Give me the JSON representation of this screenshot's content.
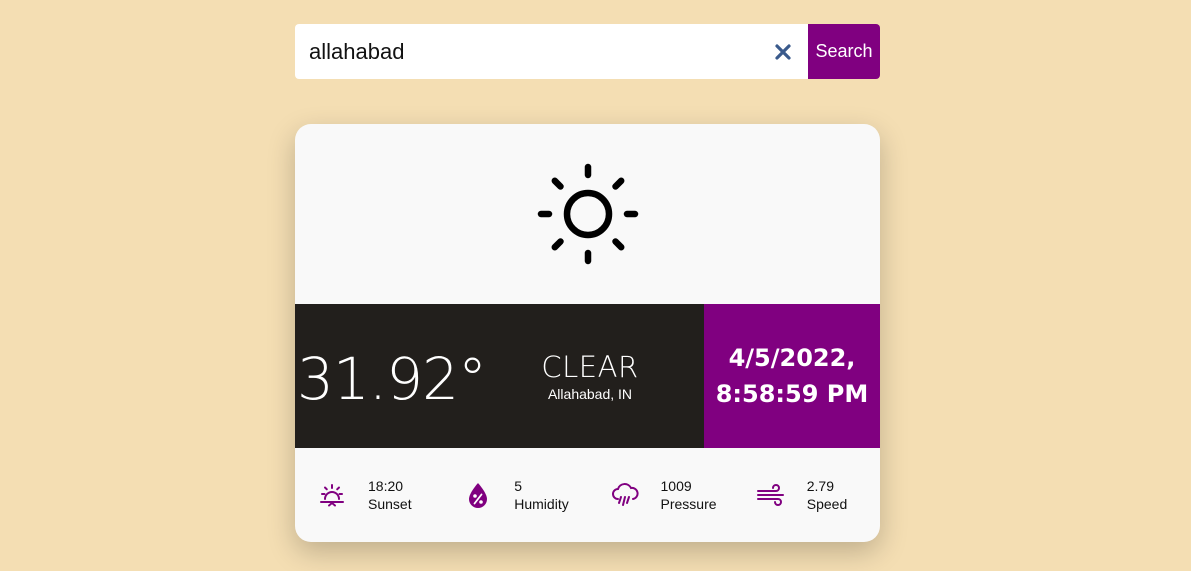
{
  "search": {
    "value": "allahabad",
    "button_label": "Search"
  },
  "weather": {
    "icon": "sun-icon",
    "temperature": "31.92°",
    "condition": "CLEAR",
    "location": "Allahabad, IN",
    "date": "4/5/2022,",
    "time": "8:58:59 PM"
  },
  "stats": [
    {
      "icon": "sunset-icon",
      "value": "18:20",
      "label": "Sunset"
    },
    {
      "icon": "humidity-icon",
      "value": "5",
      "label": "Humidity"
    },
    {
      "icon": "pressure-icon",
      "value": "1009",
      "label": "Pressure"
    },
    {
      "icon": "wind-icon",
      "value": "2.79",
      "label": "Speed"
    }
  ],
  "colors": {
    "background": "#f4deb3",
    "accent": "#800080",
    "dark_panel": "#221f1c",
    "card": "#f9f9f9",
    "clear_icon": "#3a5a8c"
  }
}
